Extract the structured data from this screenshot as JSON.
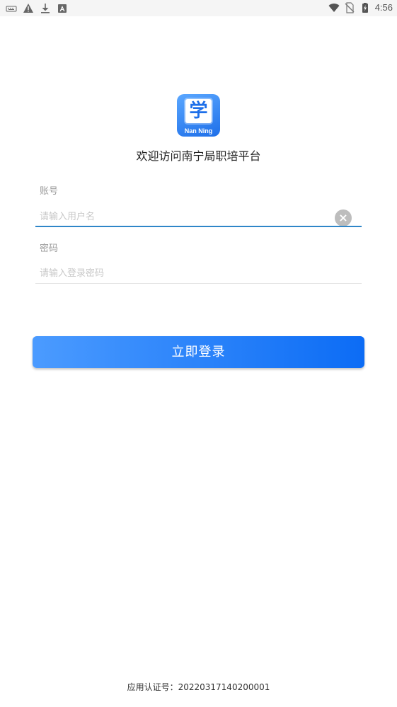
{
  "status_bar": {
    "time": "4:56",
    "left_icons": [
      "keyboard-icon",
      "warning-icon",
      "download-icon",
      "a-badge-icon"
    ],
    "right_icons": [
      "wifi-icon",
      "no-sim-icon",
      "battery-charging-icon"
    ]
  },
  "logo": {
    "char": "学",
    "subtitle": "Nan Ning"
  },
  "welcome_text": "欢迎访问南宁局职培平台",
  "account": {
    "label": "账号",
    "placeholder": "请输入用户名",
    "value": "",
    "clear_icon": "clear-icon"
  },
  "password": {
    "label": "密码",
    "placeholder": "请输入登录密码",
    "value": ""
  },
  "login_button": "立即登录",
  "footer": "应用认证号：20220317140200001",
  "colors": {
    "accent": "#2f86c8",
    "button_start": "#4b9bff",
    "button_end": "#0c6cf5",
    "label": "#9a9a9a",
    "placeholder": "#c8c8c8"
  }
}
